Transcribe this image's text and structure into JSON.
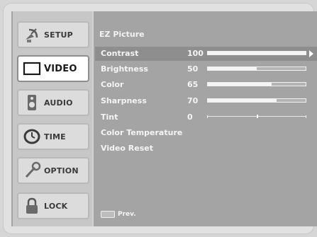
{
  "sidebar": {
    "items": [
      {
        "label": "SETUP",
        "icon": "satellite-dish-icon",
        "active": false
      },
      {
        "label": "VIDEO",
        "icon": "tv-screen-icon",
        "active": true
      },
      {
        "label": "AUDIO",
        "icon": "speaker-icon",
        "active": false
      },
      {
        "label": "TIME",
        "icon": "clock-icon",
        "active": false
      },
      {
        "label": "OPTION",
        "icon": "wrench-icon",
        "active": false
      },
      {
        "label": "LOCK",
        "icon": "padlock-icon",
        "active": false
      }
    ]
  },
  "main": {
    "title": "EZ Picture",
    "rows": [
      {
        "label": "Contrast",
        "value": "100",
        "level": 100
      },
      {
        "label": "Brightness",
        "value": "50",
        "level": 50
      },
      {
        "label": "Color",
        "value": "65",
        "level": 65
      },
      {
        "label": "Sharpness",
        "value": "70",
        "level": 70
      },
      {
        "label": "Tint",
        "value": "0",
        "level": 0
      },
      {
        "label": "Color Temperature"
      },
      {
        "label": "Video Reset"
      }
    ]
  },
  "footer": {
    "label": "Prev.",
    "icon": "menu-key-icon"
  },
  "colors": {
    "menu_background": "#a4a4a4",
    "sidebar_background": "#c7c7c7",
    "selected_row": "#8e8e8e",
    "text": "#f4f4f4"
  }
}
